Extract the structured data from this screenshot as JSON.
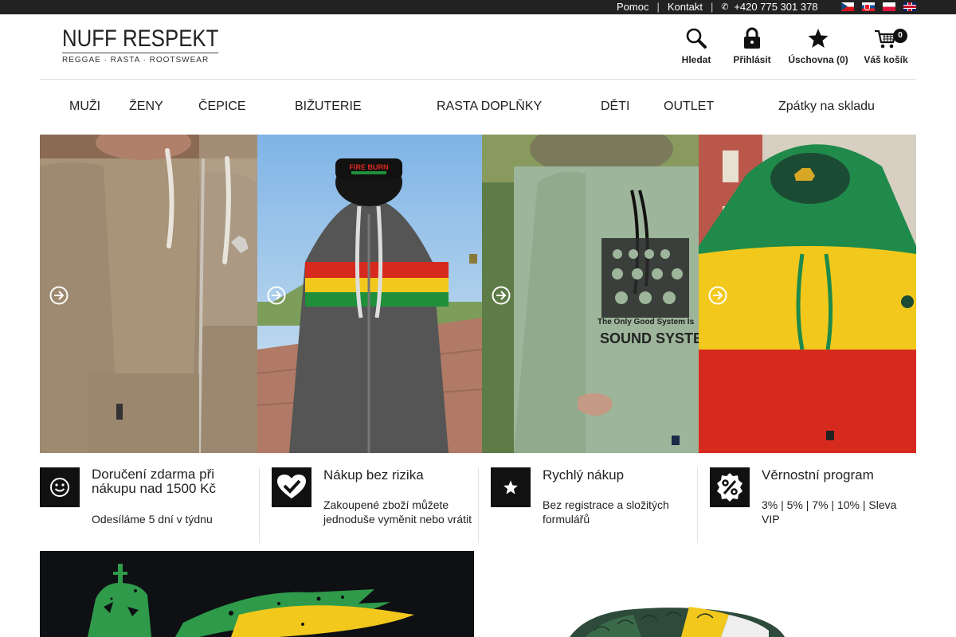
{
  "topbar": {
    "help": "Pomoc",
    "contact": "Kontakt",
    "phone": "+420 775 301 378",
    "languages": [
      "cz-flag",
      "sk-flag",
      "pl-flag",
      "gb-flag"
    ]
  },
  "logo": {
    "name": "NUFF RESPEKT",
    "tagline": "REGGAE · RASTA · ROOTSWEAR"
  },
  "header": {
    "search": "Hledat",
    "login": "Přihlásit",
    "wishlist": "Úschovna (0)",
    "cart": "Váš košík",
    "cart_count": "0"
  },
  "nav": {
    "items": [
      "MUŽI",
      "ŽENY",
      "ČEPICE",
      "BIŽUTERIE",
      "RASTA DOPLŇKY",
      "DĚTI",
      "OUTLET",
      "Zpátky na skladu"
    ]
  },
  "hero": {
    "panels": [
      {
        "icon": "arrow-right-circle-icon"
      },
      {
        "icon": "arrow-right-circle-icon"
      },
      {
        "icon": "arrow-right-circle-icon"
      },
      {
        "icon": "arrow-right-circle-icon"
      }
    ],
    "cap_text": "FIRE BURN",
    "hoodie_text_1": "The Only Good System Is",
    "hoodie_text_2": "SOUND SYSTE"
  },
  "features": [
    {
      "icon": "smile-icon",
      "title": "Doručení zdarma při nákupu nad 1500 Kč",
      "desc": "Odesíláme 5 dní v týdnu"
    },
    {
      "icon": "heart-check-icon",
      "title": "Nákup bez rizika",
      "desc": "Zakoupené zboží můžete jednoduše vyměnit nebo vrátit"
    },
    {
      "icon": "star-icon",
      "title": "Rychlý nákup",
      "desc": "Bez registrace a složitých formulářů"
    },
    {
      "icon": "percent-badge-icon",
      "title": "Věrnostní program",
      "desc": "3% | 5% | 7% | 10% | Sleva VIP"
    }
  ],
  "colors": {
    "topbar": "#222222",
    "badge": "#111111",
    "rasta_red": "#d72a1f",
    "rasta_yellow": "#f2c81c",
    "rasta_green": "#1f8f3a"
  }
}
